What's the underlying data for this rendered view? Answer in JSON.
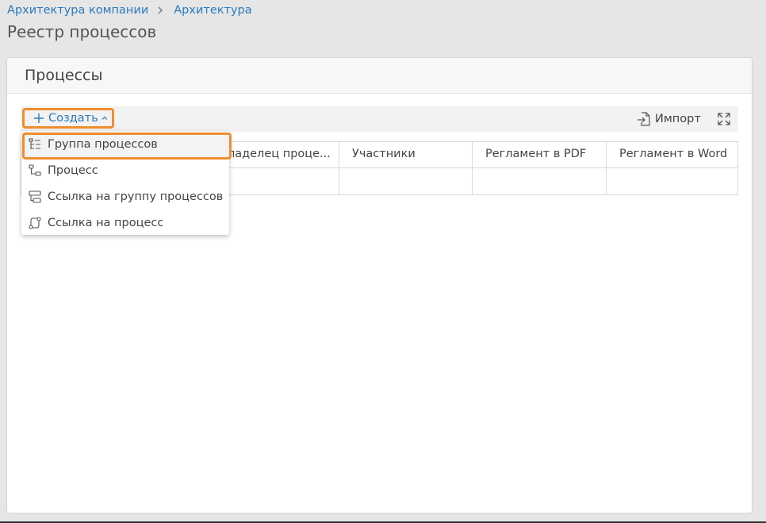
{
  "breadcrumb": {
    "items": [
      "Архитектура компании",
      "Архитектура"
    ]
  },
  "page_title": "Реестр процессов",
  "panel": {
    "title": "Процессы"
  },
  "toolbar": {
    "create_label": "Создать",
    "import_label": "Импорт"
  },
  "grid": {
    "columns": [
      "Владелец проце...",
      "Участники",
      "Регламент в PDF",
      "Регламент в Word"
    ]
  },
  "dropdown": {
    "items": [
      {
        "label": "Группа процессов",
        "icon": "process-group-icon"
      },
      {
        "label": "Процесс",
        "icon": "process-icon"
      },
      {
        "label": "Ссылка на группу процессов",
        "icon": "group-link-icon"
      },
      {
        "label": "Ссылка на процесс",
        "icon": "process-link-icon"
      }
    ],
    "highlighted_index": 0
  },
  "colors": {
    "accent": "#2a7bc0",
    "highlight_frame": "#f08d2e",
    "background": "#e6e6e6"
  }
}
